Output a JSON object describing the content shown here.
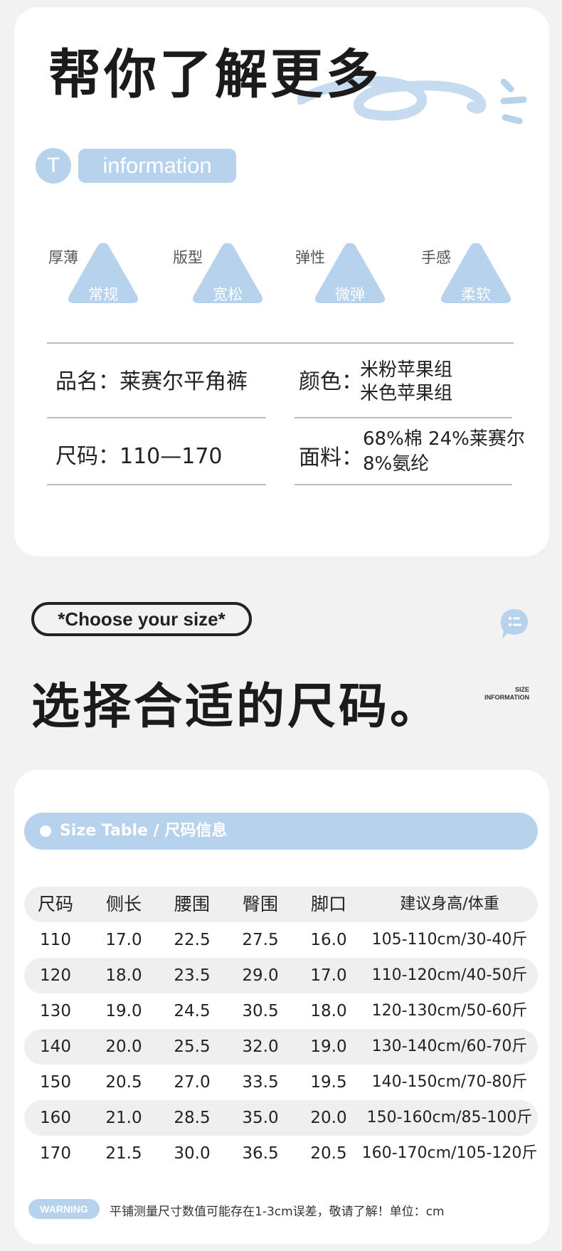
{
  "header": {
    "title": "帮你了解更多",
    "badge_letter": "T",
    "badge_label": "information"
  },
  "attributes": [
    {
      "label": "厚薄",
      "value": "常规"
    },
    {
      "label": "版型",
      "value": "宽松"
    },
    {
      "label": "弹性",
      "value": "微弹"
    },
    {
      "label": "手感",
      "value": "柔软"
    }
  ],
  "specs": {
    "name": "品名：莱赛尔平角裤",
    "color_label": "颜色：",
    "color_lines": [
      "米粉苹果组",
      "米色苹果组"
    ],
    "size": "尺码：110—170",
    "fabric_label": "面料：",
    "fabric_lines": [
      "68%棉 24%莱赛尔",
      "8%氨纶"
    ]
  },
  "size_section": {
    "choose_label": "*Choose your size*",
    "title": "选择合适的尺码。",
    "size_info_lines": [
      "SIZE",
      "INFORMATION"
    ],
    "table_bar": "Size Table / 尺码信息"
  },
  "size_table": {
    "headers": [
      "尺码",
      "侧长",
      "腰围",
      "臀围",
      "脚口",
      "建议身高/体重"
    ],
    "rows": [
      [
        "110",
        "17.0",
        "22.5",
        "27.5",
        "16.0",
        "105-110cm/30-40斤"
      ],
      [
        "120",
        "18.0",
        "23.5",
        "29.0",
        "17.0",
        "110-120cm/40-50斤"
      ],
      [
        "130",
        "19.0",
        "24.5",
        "30.5",
        "18.0",
        "120-130cm/50-60斤"
      ],
      [
        "140",
        "20.0",
        "25.5",
        "32.0",
        "19.0",
        "130-140cm/60-70斤"
      ],
      [
        "150",
        "20.5",
        "27.0",
        "33.5",
        "19.5",
        "140-150cm/70-80斤"
      ],
      [
        "160",
        "21.0",
        "28.5",
        "35.0",
        "20.0",
        "150-160cm/85-100斤"
      ],
      [
        "170",
        "21.5",
        "30.0",
        "36.5",
        "20.5",
        "160-170cm/105-120斤"
      ]
    ]
  },
  "warning": {
    "label": "WARNING",
    "text": "平铺测量尺寸数值可能存在1-3cm误差，敬请了解！单位：cm"
  },
  "colors": {
    "accent": "#b7d2ec",
    "background": "#f2f2f2",
    "card": "#ffffff",
    "text": "#222222"
  }
}
